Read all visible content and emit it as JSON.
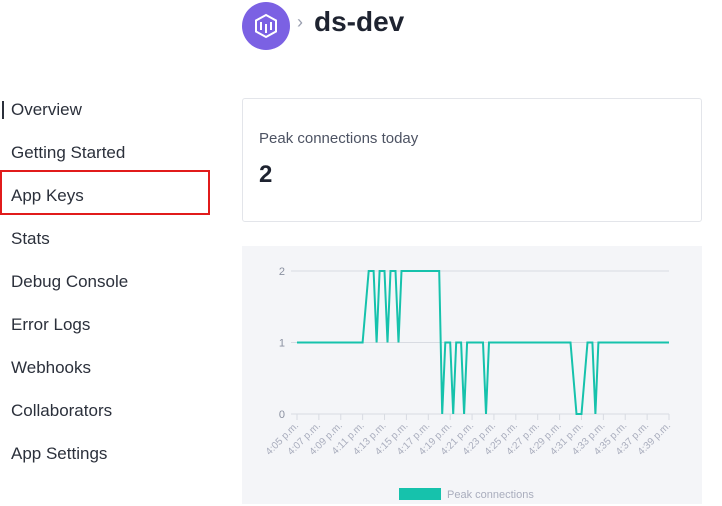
{
  "header": {
    "app_icon": "cube-logo-icon",
    "separator": "›",
    "title": "ds-dev"
  },
  "sidebar": {
    "items": [
      {
        "label": "Overview",
        "active": true
      },
      {
        "label": "Getting Started"
      },
      {
        "label": "App Keys",
        "highlighted": true
      },
      {
        "label": "Stats"
      },
      {
        "label": "Debug Console"
      },
      {
        "label": "Error Logs"
      },
      {
        "label": "Webhooks"
      },
      {
        "label": "Collaborators"
      },
      {
        "label": "App Settings"
      }
    ]
  },
  "stat_card": {
    "label": "Peak connections today",
    "value": "2"
  },
  "colors": {
    "accent": "#7b61e3",
    "series": "#16c2ac",
    "highlight": "#e11b1b"
  },
  "chart_data": {
    "type": "line",
    "title": "",
    "xlabel": "",
    "ylabel": "",
    "ylim": [
      0,
      2
    ],
    "yticks": [
      "0",
      "1",
      "2"
    ],
    "xticks": [
      "4:05 p.m.",
      "4:07 p.m.",
      "4:09 p.m.",
      "4:11 p.m.",
      "4:13 p.m.",
      "4:15 p.m.",
      "4:17 p.m.",
      "4:19 p.m.",
      "4:21 p.m.",
      "4:23 p.m.",
      "4:25 p.m.",
      "4:27 p.m.",
      "4:29 p.m.",
      "4:31 p.m.",
      "4:33 p.m.",
      "4:35 p.m.",
      "4:37 p.m.",
      "4:39 p.m."
    ],
    "legend": {
      "position": "bottom"
    },
    "series": [
      {
        "name": "Peak connections",
        "points": [
          [
            "4:05",
            1
          ],
          [
            "4:11",
            1
          ],
          [
            "4:11",
            2
          ],
          [
            "4:12",
            2
          ],
          [
            "4:12",
            1
          ],
          [
            "4:12",
            2
          ],
          [
            "4:13",
            2
          ],
          [
            "4:13",
            1
          ],
          [
            "4:13",
            2
          ],
          [
            "4:14",
            2
          ],
          [
            "4:14",
            1
          ],
          [
            "4:14",
            2
          ],
          [
            "4:18",
            2
          ],
          [
            "4:18",
            0
          ],
          [
            "4:18",
            1
          ],
          [
            "4:19",
            1
          ],
          [
            "4:19",
            0
          ],
          [
            "4:19",
            1
          ],
          [
            "4:20",
            1
          ],
          [
            "4:20",
            0
          ],
          [
            "4:20",
            1
          ],
          [
            "4:22",
            1
          ],
          [
            "4:22",
            0
          ],
          [
            "4:22",
            1
          ],
          [
            "4:30",
            1
          ],
          [
            "4:30",
            0
          ],
          [
            "4:31",
            0
          ],
          [
            "4:31",
            1
          ],
          [
            "4:32",
            1
          ],
          [
            "4:32",
            0
          ],
          [
            "4:32",
            1
          ],
          [
            "4:39",
            1
          ]
        ]
      }
    ]
  }
}
